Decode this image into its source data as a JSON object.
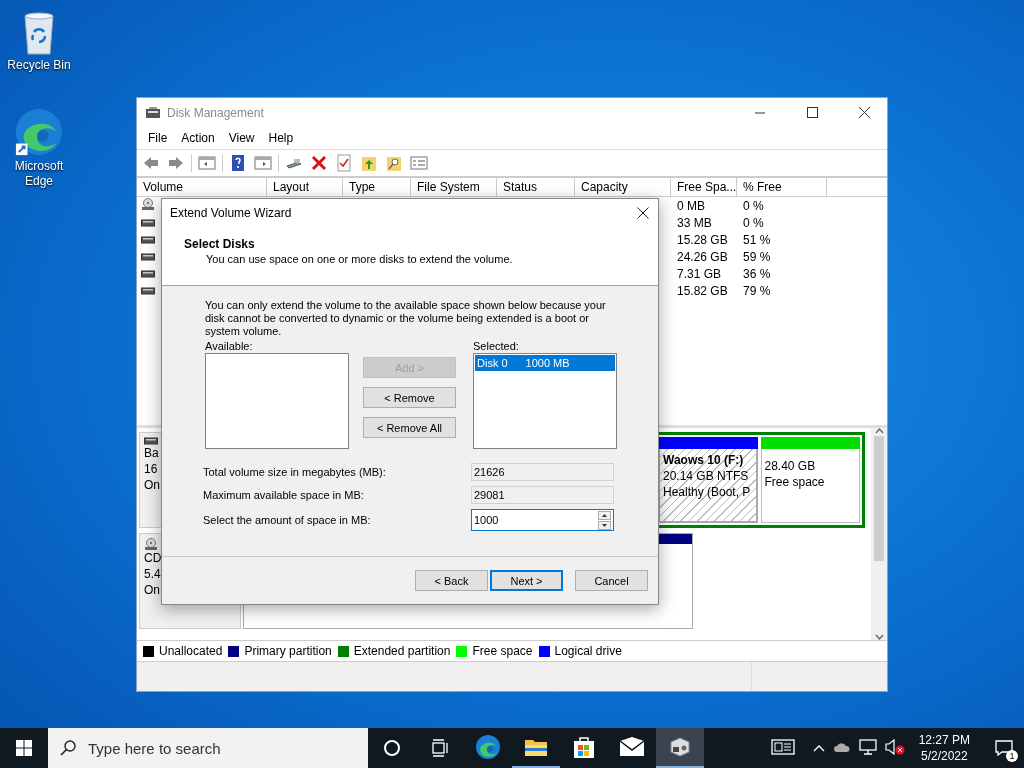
{
  "desktop": {
    "icons": [
      {
        "kind": "recycle-bin",
        "label": "Recycle Bin"
      },
      {
        "kind": "edge",
        "label": "Microsoft Edge"
      }
    ]
  },
  "window": {
    "title": "Disk Management",
    "menu": [
      "File",
      "Action",
      "View",
      "Help"
    ],
    "table": {
      "columns": [
        "Volume",
        "Layout",
        "Type",
        "File System",
        "Status",
        "Capacity",
        "Free Spa...",
        "% Free"
      ],
      "rows": [
        {
          "kind": "cd",
          "free": "0 MB",
          "percent_free": "0 %"
        },
        {
          "kind": "disk",
          "free": "33 MB",
          "percent_free": "0 %"
        },
        {
          "kind": "disk",
          "free": "15.28 GB",
          "percent_free": "51 %"
        },
        {
          "kind": "disk",
          "free": "24.26 GB",
          "percent_free": "59 %"
        },
        {
          "kind": "disk",
          "free": "7.31 GB",
          "percent_free": "36 %"
        },
        {
          "kind": "disk",
          "free": "15.82 GB",
          "percent_free": "79 %"
        }
      ]
    },
    "disks": [
      {
        "kind": "disk",
        "labels": [
          "Ba",
          "16",
          "On"
        ],
        "partitions": [
          {
            "kind": "extended",
            "color": "#008000",
            "children": [
              {
                "kind": "volume",
                "color": "#0000ff",
                "selected": true,
                "name": "Waows 10  (F:)",
                "size": "20.14 GB NTFS",
                "status": "Healthy (Boot, P"
              },
              {
                "kind": "free",
                "color": "#00e000",
                "selected": false,
                "size": "28.40 GB",
                "status": "Free space"
              }
            ]
          }
        ]
      },
      {
        "kind": "cd",
        "labels": [
          "CD",
          "5.4",
          "On"
        ],
        "partitions": [
          {
            "kind": "primary",
            "color": "#000080"
          }
        ]
      }
    ],
    "legend": [
      {
        "label": "Unallocated",
        "color": "#000000"
      },
      {
        "label": "Primary partition",
        "color": "#000080"
      },
      {
        "label": "Extended partition",
        "color": "#008000"
      },
      {
        "label": "Free space",
        "color": "#00ff00"
      },
      {
        "label": "Logical drive",
        "color": "#0000ff"
      }
    ]
  },
  "dialog": {
    "title": "Extend Volume Wizard",
    "heading": "Select Disks",
    "subheading": "You can use space on one or more disks to extend the volume.",
    "note": "You can only extend the volume to the available space shown below because your disk cannot be converted to dynamic or the volume being extended is a boot or system volume.",
    "available_label": "Available:",
    "selected_label": "Selected:",
    "selected_items": [
      {
        "disk": "Disk 0",
        "size": "1000 MB",
        "selected": true
      }
    ],
    "transfer_buttons": [
      {
        "label": "Add >",
        "disabled": true
      },
      {
        "label": "< Remove",
        "disabled": false
      },
      {
        "label": "< Remove All",
        "disabled": false
      }
    ],
    "fields": [
      {
        "kind": "readonly",
        "label": "Total volume size in megabytes (MB):",
        "value": "21626"
      },
      {
        "kind": "readonly",
        "label": "Maximum available space in MB:",
        "value": "29081"
      },
      {
        "kind": "spinner",
        "label": "Select the amount of space in MB:",
        "value": "1000"
      }
    ],
    "buttons": [
      {
        "label": "< Back",
        "default": false
      },
      {
        "label": "Next >",
        "default": true
      },
      {
        "label": "Cancel",
        "default": false
      }
    ]
  },
  "taskbar": {
    "search_placeholder": "Type here to search",
    "apps": [
      {
        "kind": "edge",
        "running": false,
        "active": false
      },
      {
        "kind": "explorer",
        "running": true,
        "active": false
      },
      {
        "kind": "store",
        "running": false,
        "active": false
      },
      {
        "kind": "mail",
        "running": false,
        "active": false
      },
      {
        "kind": "disk-management",
        "running": true,
        "active": true
      }
    ],
    "time": "12:27 PM",
    "date": "5/2/2022",
    "notification_badge": "1"
  }
}
